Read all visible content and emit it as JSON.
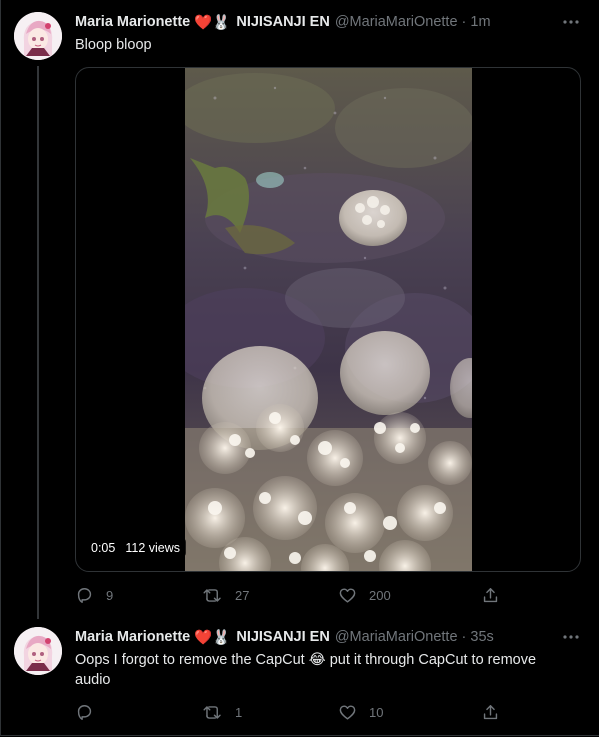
{
  "tweets": [
    {
      "display_name": "Maria Marionette",
      "emoji": "❤️🐰",
      "affiliation": "NIJISANJI EN",
      "handle": "@MariaMariOnette",
      "separator": "·",
      "time": "1m",
      "text": "Bloop bloop",
      "video": {
        "duration": "0:05",
        "views": "112 views"
      },
      "replies": "9",
      "retweets": "27",
      "likes": "200"
    },
    {
      "display_name": "Maria Marionette",
      "emoji": "❤️🐰",
      "affiliation": "NIJISANJI EN",
      "handle": "@MariaMariOnette",
      "separator": "·",
      "time": "35s",
      "text": "Oops I forgot to remove the CapCut 😂 put it through CapCut to remove audio",
      "replies": "",
      "retweets": "1",
      "likes": "10"
    }
  ],
  "colors": {
    "background": "#000000",
    "text_primary": "#e7e9ea",
    "text_secondary": "#71767b",
    "border": "#2f3336"
  }
}
